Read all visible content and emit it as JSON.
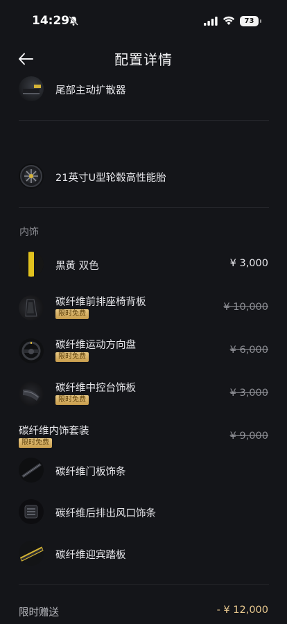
{
  "status_bar": {
    "time": "14:29",
    "battery": "73"
  },
  "header": {
    "title": "配置详情"
  },
  "items_top": [
    {
      "label": "尾部主动扩散器"
    },
    {
      "label": "21英寸U型轮毂高性能胎"
    }
  ],
  "interior": {
    "section_title": "内饰",
    "items": [
      {
        "label": "黑黄 双色",
        "price": "¥ 3,000"
      },
      {
        "label": "碳纤维前排座椅背板",
        "badge": "限时免费",
        "price": "¥ 10,000"
      },
      {
        "label": "碳纤维运动方向盘",
        "badge": "限时免费",
        "price": "¥ 6,000"
      },
      {
        "label": "碳纤维中控台饰板",
        "badge": "限时免费",
        "price": "¥ 3,000"
      }
    ],
    "package": {
      "label": "碳纤维内饰套装",
      "badge": "限时免费",
      "price": "¥ 9,000"
    },
    "package_items": [
      {
        "label": "碳纤维门板饰条"
      },
      {
        "label": "碳纤维后排出风口饰条"
      },
      {
        "label": "碳纤维迎宾踏板"
      }
    ]
  },
  "summary": {
    "label": "限时赠送",
    "value": "- ¥ 12,000"
  },
  "colors": {
    "accent_gold": "#e9c98f",
    "badge_gold": "#d7b068",
    "background": "#141519"
  }
}
